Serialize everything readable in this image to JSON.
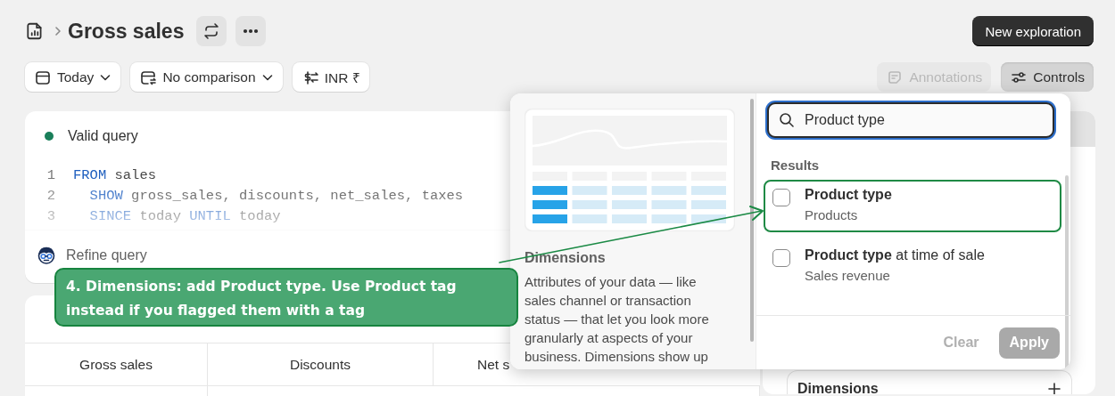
{
  "header": {
    "title": "Gross sales",
    "new_button": "New exploration"
  },
  "toolbar": {
    "filters": [
      {
        "label": "Today",
        "kind": "date"
      },
      {
        "label": "No comparison",
        "kind": "comparison"
      },
      {
        "label": "INR ₹",
        "kind": "currency"
      }
    ],
    "actions": [
      {
        "label": "Annotations",
        "kind": "annotations",
        "disabled": true,
        "selected": false
      },
      {
        "label": "Controls",
        "kind": "controls",
        "disabled": false,
        "selected": true
      }
    ]
  },
  "query": {
    "status": {
      "label": "Valid query",
      "valid": true
    },
    "lines": [
      {
        "number": "1",
        "tokens": [
          {
            "text": "FROM",
            "kind": "keyword"
          },
          {
            "text": " sales",
            "kind": "plain"
          }
        ]
      },
      {
        "number": "2",
        "tokens": [
          {
            "text": "  SHOW",
            "kind": "keyword"
          },
          {
            "text": " gross_sales, discounts, net_sales, taxes",
            "kind": "plain"
          }
        ]
      },
      {
        "number": "3",
        "tokens": [
          {
            "text": "  SINCE",
            "kind": "keyword"
          },
          {
            "text": " today ",
            "kind": "plain"
          },
          {
            "text": "UNTIL",
            "kind": "keyword"
          },
          {
            "text": " today",
            "kind": "plain"
          }
        ]
      }
    ],
    "refine": "Refine query"
  },
  "table": {
    "columns": [
      "Gross sales",
      "Discounts",
      "Net s"
    ]
  },
  "side_panel": {
    "dimensions_label": "Dimensions"
  },
  "popover": {
    "preview_title": "Dimensions",
    "preview_text": "Attributes of your data — like sales channel or transaction status — that let you look more granularly at aspects of your business. Dimensions show up",
    "search": {
      "value": "Product type"
    },
    "results_heading": "Results",
    "results": [
      {
        "match": "Product type",
        "subtitle": "Products",
        "checked": false,
        "highlighted": true
      },
      {
        "match": "Product type",
        "rest": " at time of sale",
        "subtitle": "Sales revenue",
        "checked": false,
        "highlighted": false
      }
    ],
    "buttons": [
      {
        "label": "Clear",
        "kind": "text",
        "disabled": true
      },
      {
        "label": "Apply",
        "kind": "filled",
        "disabled": true
      }
    ]
  },
  "callout": {
    "text": "4. Dimensions: add Product type. Use Product tag instead if you flagged them with a tag"
  }
}
